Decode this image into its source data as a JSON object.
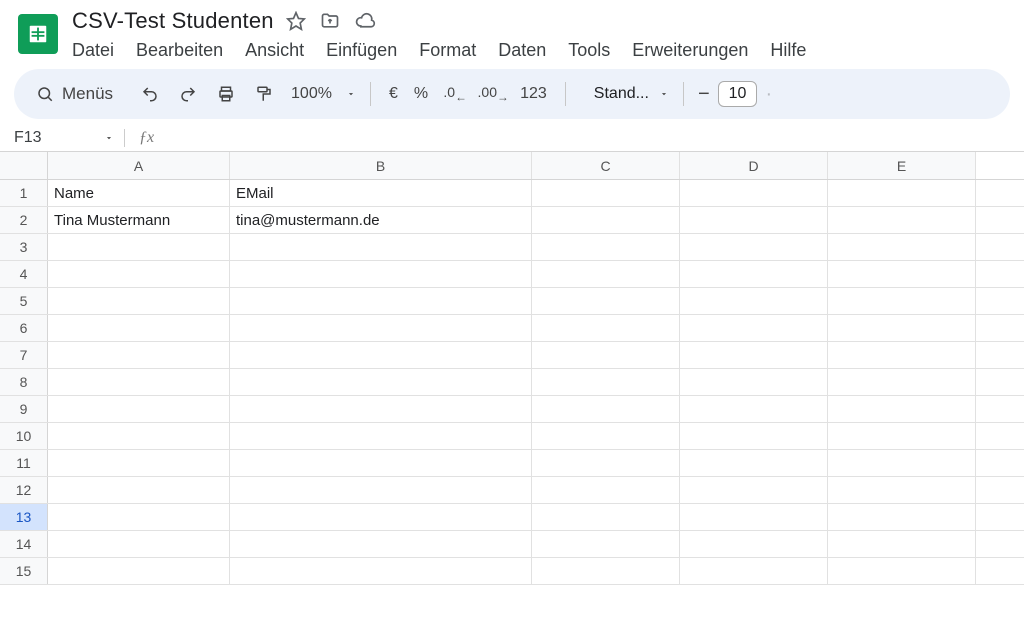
{
  "doc": {
    "title": "CSV-Test Studenten"
  },
  "menubar": [
    "Datei",
    "Bearbeiten",
    "Ansicht",
    "Einfügen",
    "Format",
    "Daten",
    "Tools",
    "Erweiterungen",
    "Hilfe"
  ],
  "toolbar": {
    "search_label": "Menüs",
    "zoom": "100%",
    "currency": "€",
    "percent": "%",
    "dec_less": ".0",
    "dec_more": ".00",
    "fmt123": "123",
    "font_name": "Stand...",
    "font_size": "10"
  },
  "namebox": {
    "cell_ref": "F13",
    "formula": ""
  },
  "columns": [
    "A",
    "B",
    "C",
    "D",
    "E"
  ],
  "rows": [
    {
      "n": 1,
      "cells": [
        "Name",
        "EMail",
        "",
        "",
        ""
      ]
    },
    {
      "n": 2,
      "cells": [
        "Tina Mustermann",
        "tina@mustermann.de",
        "",
        "",
        ""
      ]
    },
    {
      "n": 3,
      "cells": [
        "",
        "",
        "",
        "",
        ""
      ]
    },
    {
      "n": 4,
      "cells": [
        "",
        "",
        "",
        "",
        ""
      ]
    },
    {
      "n": 5,
      "cells": [
        "",
        "",
        "",
        "",
        ""
      ]
    },
    {
      "n": 6,
      "cells": [
        "",
        "",
        "",
        "",
        ""
      ]
    },
    {
      "n": 7,
      "cells": [
        "",
        "",
        "",
        "",
        ""
      ]
    },
    {
      "n": 8,
      "cells": [
        "",
        "",
        "",
        "",
        ""
      ]
    },
    {
      "n": 9,
      "cells": [
        "",
        "",
        "",
        "",
        ""
      ]
    },
    {
      "n": 10,
      "cells": [
        "",
        "",
        "",
        "",
        ""
      ]
    },
    {
      "n": 11,
      "cells": [
        "",
        "",
        "",
        "",
        ""
      ]
    },
    {
      "n": 12,
      "cells": [
        "",
        "",
        "",
        "",
        ""
      ]
    },
    {
      "n": 13,
      "cells": [
        "",
        "",
        "",
        "",
        ""
      ]
    },
    {
      "n": 14,
      "cells": [
        "",
        "",
        "",
        "",
        ""
      ]
    },
    {
      "n": 15,
      "cells": [
        "",
        "",
        "",
        "",
        ""
      ]
    }
  ],
  "selected_row": 13
}
